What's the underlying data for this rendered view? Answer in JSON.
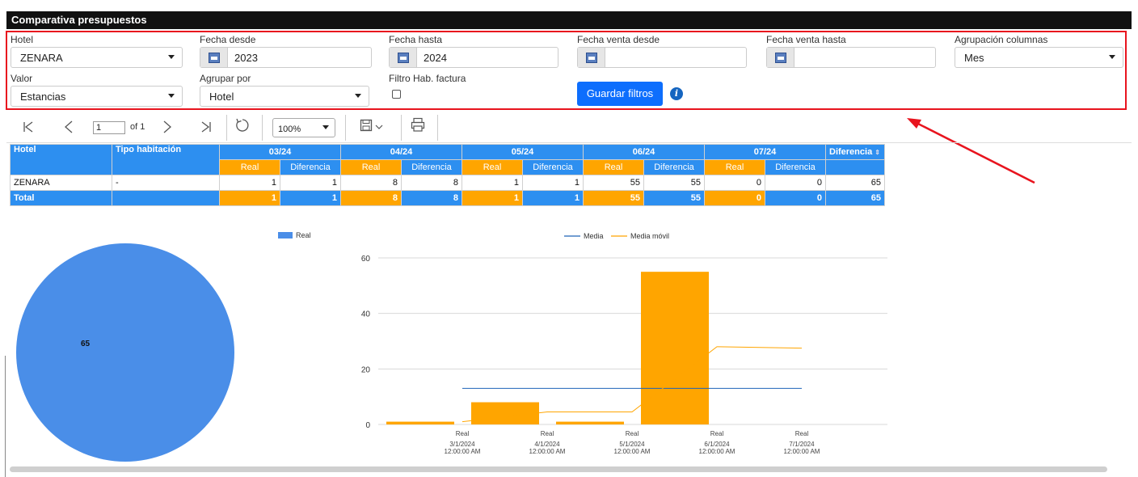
{
  "app": {
    "title": "Comparativa presupuestos"
  },
  "filters": {
    "hotel": {
      "label": "Hotel",
      "value": "ZENARA"
    },
    "fecha_desde": {
      "label": "Fecha desde",
      "value": "2023"
    },
    "fecha_hasta": {
      "label": "Fecha hasta",
      "value": "2024"
    },
    "fecha_venta_desde": {
      "label": "Fecha venta desde",
      "value": ""
    },
    "fecha_venta_hasta": {
      "label": "Fecha venta hasta",
      "value": ""
    },
    "agrupacion_columnas": {
      "label": "Agrupación columnas",
      "value": "Mes"
    },
    "valor": {
      "label": "Valor",
      "value": "Estancias"
    },
    "agrupar_por": {
      "label": "Agrupar por",
      "value": "Hotel"
    },
    "filtro_hab_factura": {
      "label": "Filtro Hab. factura",
      "checked": false
    },
    "save_label": "Guardar filtros",
    "info_glyph": "i"
  },
  "toolbar": {
    "page_value": "1",
    "page_of": "of 1",
    "zoom": "100%",
    "icons": [
      "first-page-icon",
      "prev-page-icon",
      "next-page-icon",
      "last-page-icon",
      "refresh-icon",
      "save-icon",
      "print-icon"
    ]
  },
  "table": {
    "headers": {
      "hotel": "Hotel",
      "tipo": "Tipo habitación",
      "diferencia": "Diferencia"
    },
    "sub_real": "Real",
    "sub_diferencia": "Diferencia",
    "months": [
      "03/24",
      "04/24",
      "05/24",
      "06/24",
      "07/24"
    ],
    "rows": [
      {
        "hotel": "ZENARA",
        "tipo": "-",
        "values": [
          [
            "1",
            "1"
          ],
          [
            "8",
            "8"
          ],
          [
            "1",
            "1"
          ],
          [
            "55",
            "55"
          ],
          [
            "0",
            "0"
          ]
        ],
        "diferencia": "65"
      }
    ],
    "total": {
      "label": "Total",
      "tipo": "",
      "values": [
        [
          "1",
          "1"
        ],
        [
          "8",
          "8"
        ],
        [
          "1",
          "1"
        ],
        [
          "55",
          "55"
        ],
        [
          "0",
          "0"
        ]
      ],
      "diferencia": "65"
    }
  },
  "colors": {
    "blue": "#2d8ff0",
    "orange": "#ffa500",
    "pie": "#4a8ee8",
    "media": "#1f63b8",
    "red": "#e8141e"
  },
  "chart_data": [
    {
      "type": "pie",
      "legend": [
        "Real"
      ],
      "slices": [
        {
          "label": "Real",
          "value": 65
        }
      ],
      "data_label": "65"
    },
    {
      "type": "bar",
      "legend": [
        "Media",
        "Media móvil"
      ],
      "categories": [
        "3/1/2024",
        "4/1/2024",
        "5/1/2024",
        "6/1/2024",
        "7/1/2024"
      ],
      "category_time": "12:00:00 AM",
      "bar_label": "Real",
      "series": [
        {
          "name": "Real",
          "values": [
            1,
            8,
            1,
            55,
            0
          ]
        }
      ],
      "lines": [
        {
          "name": "Media",
          "values": [
            13,
            13,
            13,
            13,
            13
          ]
        },
        {
          "name": "Media móvil",
          "values": [
            1,
            4.5,
            4.5,
            28,
            27.5
          ]
        }
      ],
      "yticks": [
        "0",
        "20",
        "40",
        "60"
      ],
      "ylim": [
        0,
        60
      ]
    }
  ]
}
